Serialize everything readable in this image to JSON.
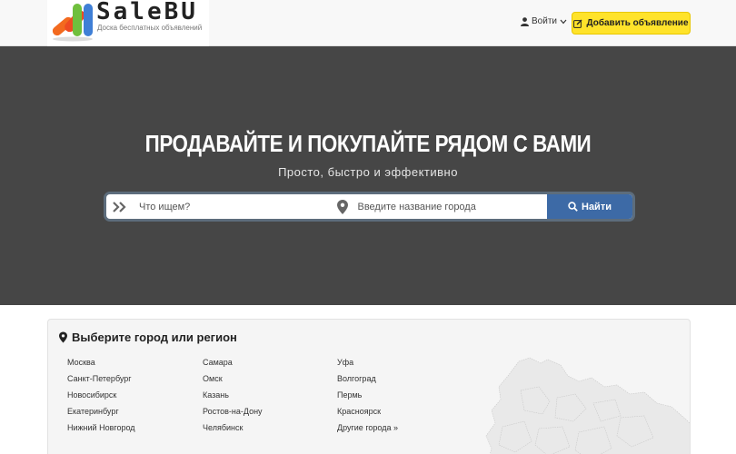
{
  "header": {
    "logo_title": "SaleBU",
    "logo_subtitle": "Доска бесплатных объявлений",
    "login_label": "Войти",
    "add_button_label": "Добавить объявление"
  },
  "hero": {
    "title": "ПРОДАВАЙТЕ И ПОКУПАЙТЕ РЯДОМ С ВАМИ",
    "subtitle": "Просто, быстро и эффективно",
    "search": {
      "what_placeholder": "Что ищем?",
      "city_placeholder": "Введите название города",
      "button_label": "Найти"
    }
  },
  "cities": {
    "title": "Выберите город или регион",
    "columns": [
      [
        "Москва",
        "Санкт-Петербург",
        "Новосибирск",
        "Екатеринбург",
        "Нижний Новгород"
      ],
      [
        "Самара",
        "Омск",
        "Казань",
        "Ростов-на-Дону",
        "Челябинск"
      ],
      [
        "Уфа",
        "Волгоград",
        "Пермь",
        "Красноярск",
        "Другие города »"
      ]
    ]
  },
  "colors": {
    "accent_yellow": "#ffe32a",
    "search_button": "#3d6aa6",
    "hero_bg": "#464646"
  }
}
